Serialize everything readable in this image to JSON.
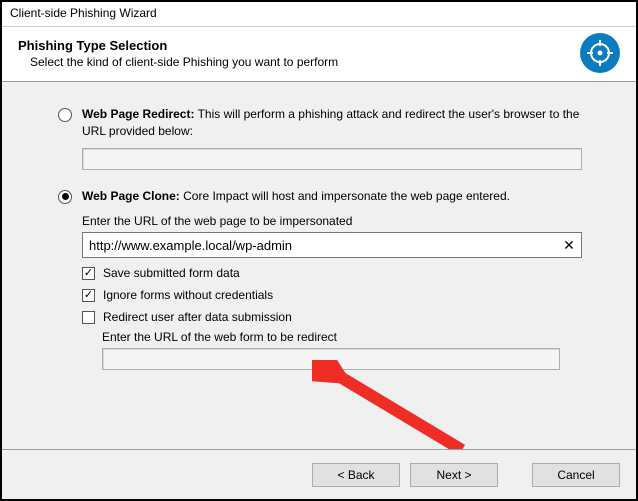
{
  "window": {
    "title": "Client-side Phishing Wizard"
  },
  "header": {
    "title": "Phishing Type Selection",
    "subtitle": "Select the kind of client-side Phishing you want to perform"
  },
  "options": {
    "redirect": {
      "label_bold": "Web Page Redirect:",
      "label_rest": " This will perform a phishing attack and redirect the user's browser to the URL provided below:",
      "selected": false
    },
    "clone": {
      "label_bold": "Web Page Clone:",
      "label_rest": " Core Impact will host and impersonate the web page entered.",
      "selected": true,
      "url_prompt": "Enter the URL of the web page to be impersonated",
      "url_value": "http://www.example.local/wp-admin",
      "save_form_data": {
        "label": "Save submitted form data",
        "checked": true
      },
      "ignore_forms": {
        "label": "Ignore forms without credentials",
        "checked": true
      },
      "redirect_after": {
        "label": "Redirect user after data submission",
        "checked": false,
        "sub_prompt": "Enter the URL of the web form to be redirect"
      }
    }
  },
  "footer": {
    "back": "< Back",
    "next": "Next >",
    "cancel": "Cancel"
  },
  "icon": {
    "name": "target-icon"
  }
}
